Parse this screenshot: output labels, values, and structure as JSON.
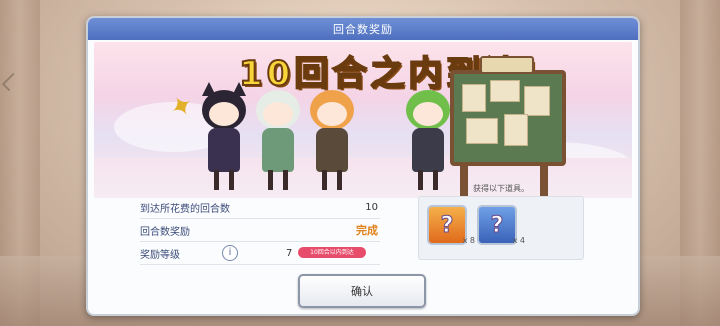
{
  "dialog": {
    "title": "回合数奖励",
    "headline": "10回合之内到达!",
    "stats": {
      "turns_label": "到达所花费的回合数",
      "turns_value": "10",
      "reward_label": "回合数奖励",
      "reward_value": "完成",
      "level_label": "奖励等级",
      "level_value": "7",
      "level_badge": "10回合以内到达"
    },
    "rewards": {
      "caption": "获得以下道具。",
      "items": [
        {
          "name": "mystery-item-orange",
          "count": "x 8"
        },
        {
          "name": "mystery-item-blue",
          "count": "x 4"
        }
      ]
    },
    "confirm_label": "确认"
  },
  "colors": {
    "title_bar": "#5b7bc9",
    "headline": "#f7d43a",
    "complete": "#e0821b",
    "badge": "#e84c6b"
  }
}
